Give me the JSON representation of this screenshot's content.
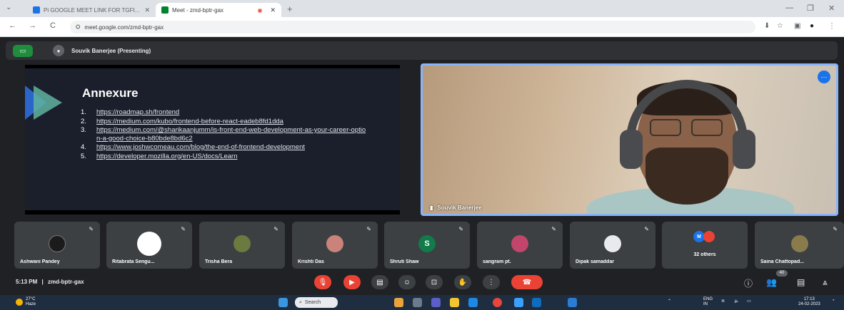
{
  "browser": {
    "tabs": [
      {
        "label": "Pi GOOGLE MEET LINK FOR TGFI...",
        "active": false
      },
      {
        "label": "Meet - zmd-bptr-gax",
        "active": true
      }
    ],
    "new_tab": "+",
    "url": "meet.google.com/zmd-bptr-gax",
    "nav": {
      "back": "←",
      "forward": "→",
      "reload": "C"
    }
  },
  "presenting_bar": {
    "text": "Souvik Banerjee (Presenting)"
  },
  "slide": {
    "title": "Annexure",
    "links": [
      {
        "num": "1.",
        "url": "https://roadmap.sh/frontend"
      },
      {
        "num": "2.",
        "url": "https://medium.com/kubo/frontend-before-react-eadeb8fd1dda"
      },
      {
        "num": "3.",
        "url": "https://medium.com/@sharikaanjumm/is-front-end-web-development-as-your-career-option-a-good-choice-b80bde8bd6c2"
      },
      {
        "num": "4.",
        "url": "https://www.joshwcomeau.com/blog/the-end-of-frontend-development"
      },
      {
        "num": "5.",
        "url": "https://developer.mozilla.org/en-US/docs/Learn"
      }
    ]
  },
  "video": {
    "name": "Souvik Banerjee"
  },
  "participants": [
    {
      "name": "Ashwani Pandey",
      "avatar_color": "#1b1b1b"
    },
    {
      "name": "Ritabrata Sengu...",
      "avatar_color": "#ffffff"
    },
    {
      "name": "Trisha Bera",
      "avatar_color": "#6b7a3e"
    },
    {
      "name": "Krishti Das",
      "avatar_color": "#c9837b"
    },
    {
      "name": "Shruti Shaw",
      "avatar_color": "#137a4a",
      "initial": "S"
    },
    {
      "name": "sangram pt.",
      "avatar_color": "#c2456b"
    },
    {
      "name": "Dipak samaddar",
      "avatar_color": "#e8eaed"
    },
    {
      "name": "32 others",
      "avatar_color": "#1a73e8",
      "initial": "M"
    },
    {
      "name": "Saina Chattopad...",
      "avatar_color": "#8a7b4c"
    }
  ],
  "meeting": {
    "time": "5:13 PM",
    "separator": "|",
    "code": "zmd-bptr-gax",
    "chat_badge": "40"
  },
  "taskbar": {
    "weather_temp": "27°C",
    "weather_desc": "Haze",
    "search": "Search",
    "lang": "ENG",
    "lang2": "IN",
    "time": "17:13",
    "date": "24-02-2023"
  },
  "colors": {
    "meet_bg": "#202124",
    "accent_blue": "#8ab4f8",
    "end_call_red": "#ea4335"
  }
}
